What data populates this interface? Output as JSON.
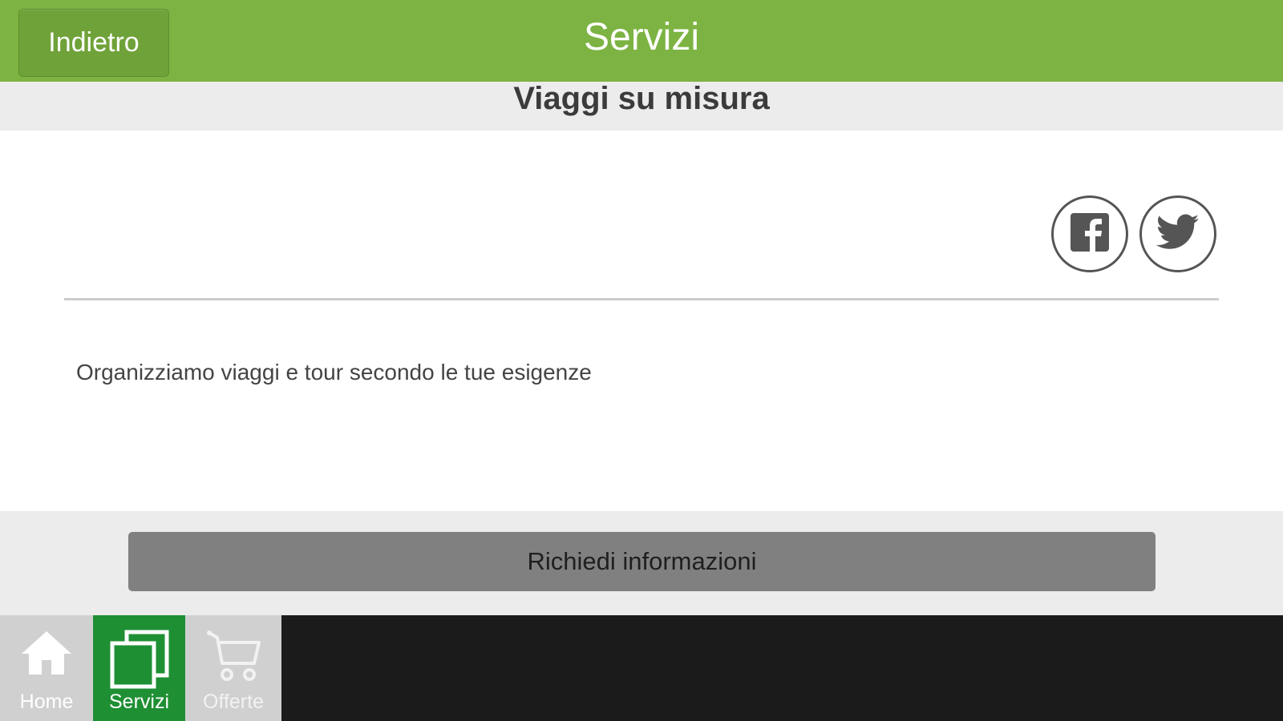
{
  "header": {
    "back_label": "Indietro",
    "title": "Servizi"
  },
  "subheader": {
    "title": "Viaggi su misura"
  },
  "content": {
    "social": [
      "facebook-icon",
      "twitter-icon"
    ],
    "description": "Organizziamo viaggi e tour secondo le tue esigenze"
  },
  "actions": {
    "request_label": "Richiedi informazioni"
  },
  "nav": {
    "items": [
      {
        "label": "Home",
        "icon": "home-icon",
        "active": false
      },
      {
        "label": "Servizi",
        "icon": "servizi-icon",
        "active": true
      },
      {
        "label": "Offerte",
        "icon": "cart-icon",
        "active": false
      }
    ]
  },
  "colors": {
    "header": "#7cb342",
    "active_tab": "#1f8f34",
    "button": "#808080",
    "nav_background": "#1b1b1b"
  }
}
